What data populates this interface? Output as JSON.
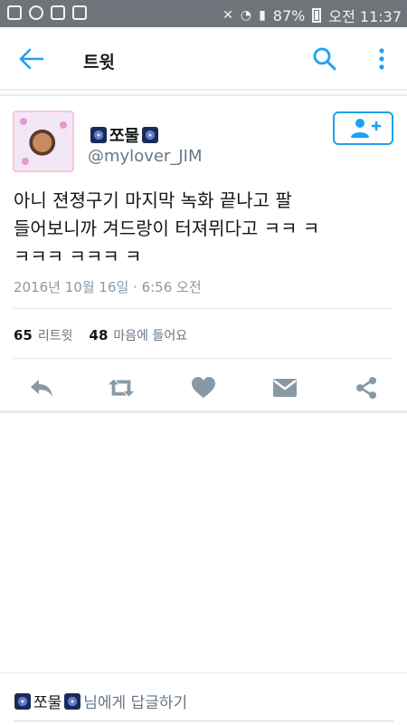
{
  "status_bar": {
    "battery_text": "87%",
    "time": "오전 11:37"
  },
  "header": {
    "title": "트윗",
    "back_icon": "arrow-left-icon",
    "search_icon": "search-icon",
    "more_icon": "more-vertical-icon"
  },
  "tweet": {
    "display_name": "쪼물",
    "handle": "@mylover_JIM",
    "text_line1": "아니 젼졍구기 마지막 녹화 끝나고 팔",
    "text_line2": "들어보니까 겨드랑이 터져뮈다고 ㅋㅋ ㅋ",
    "text_line3": "ㅋㅋㅋ ㅋㅋㅋ ㅋ",
    "timestamp": "2016년 10월 16일 · 6:56 오전",
    "retweet_count": "65",
    "retweet_label": "리트윗",
    "like_count": "48",
    "like_label": "마음에 들어요"
  },
  "actions": [
    "reply-icon",
    "retweet-icon",
    "heart-icon",
    "message-icon",
    "share-icon"
  ],
  "reply": {
    "name": "쪼물",
    "suffix": "님에게 답글하기"
  },
  "colors": {
    "accent": "#1da1f2",
    "icon_gray": "#8899a6",
    "status_bar": "#6e747a"
  }
}
